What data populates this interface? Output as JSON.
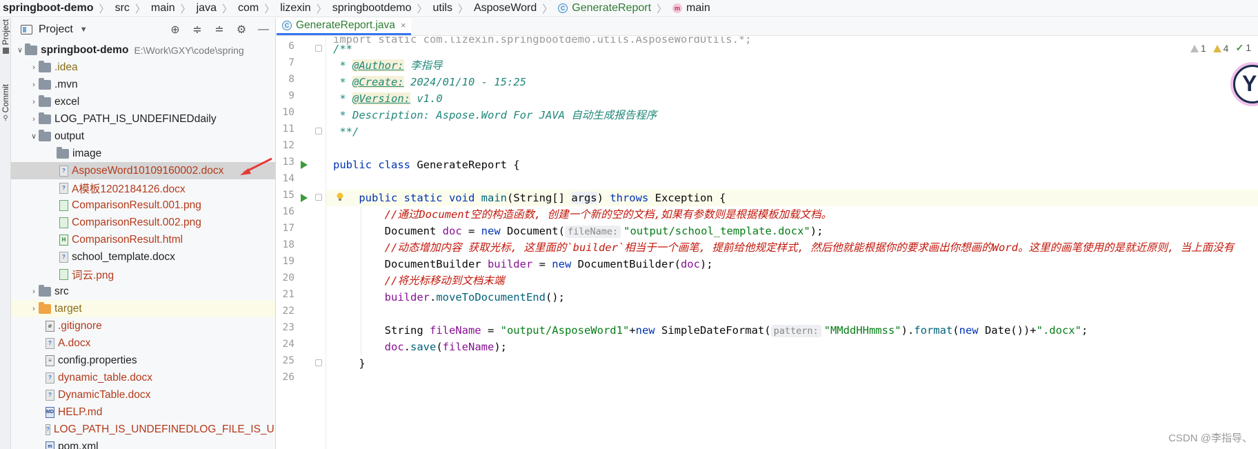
{
  "breadcrumb": {
    "items": [
      "springboot-demo",
      "src",
      "main",
      "java",
      "com",
      "lizexin",
      "springbootdemo",
      "utils",
      "AsposeWord",
      "GenerateReport",
      "main"
    ]
  },
  "sidebar_strip": {
    "project_tab": "Project",
    "commit_tab": "Commit"
  },
  "project_panel": {
    "title": "Project",
    "tree": [
      {
        "name": "springboot-demo",
        "hint": "E:\\Work\\GXY\\code\\spring"
      },
      {
        "name": ".idea"
      },
      {
        "name": ".mvn"
      },
      {
        "name": "excel"
      },
      {
        "name": "LOG_PATH_IS_UNDEFINEDdaily"
      },
      {
        "name": "output"
      },
      {
        "name": "image"
      },
      {
        "name": "AsposeWord10109160002.docx"
      },
      {
        "name": "A模板1202184126.docx"
      },
      {
        "name": "ComparisonResult.001.png"
      },
      {
        "name": "ComparisonResult.002.png"
      },
      {
        "name": "ComparisonResult.html"
      },
      {
        "name": "school_template.docx"
      },
      {
        "name": "词云.png"
      },
      {
        "name": "src"
      },
      {
        "name": "target"
      },
      {
        "name": ".gitignore"
      },
      {
        "name": "A.docx"
      },
      {
        "name": "config.properties"
      },
      {
        "name": "dynamic_table.docx"
      },
      {
        "name": "DynamicTable.docx"
      },
      {
        "name": "HELP.md"
      },
      {
        "name": "LOG_PATH_IS_UNDEFINEDLOG_FILE_IS_UN"
      },
      {
        "name": "pom.xml"
      }
    ]
  },
  "editor": {
    "tab_label": "GenerateReport.java",
    "top_partial": "import static com.lizexin.springbootdemo.utils.AsposeWordUtils.*;",
    "line_numbers": [
      "6",
      "7",
      "8",
      "9",
      "10",
      "11",
      "12",
      "13",
      "14",
      "15",
      "16",
      "17",
      "18",
      "19",
      "20",
      "21",
      "22",
      "23",
      "24",
      "25",
      "26"
    ],
    "inspections": {
      "weak": "1",
      "warn": "4",
      "ok": "1"
    },
    "code": {
      "l6": "/**",
      "l7_pre": " * ",
      "l7_tag": "@Author:",
      "l7_val": " 李指导",
      "l8_pre": " * ",
      "l8_tag": "@Create:",
      "l8_val": " 2024/01/10 - 15:25",
      "l9_pre": " * ",
      "l9_tag": "@Version:",
      "l9_val": " v1.0",
      "l10": " * Description: Aspose.Word For JAVA 自动生成报告程序",
      "l11": " **/",
      "l13_kw": "public class",
      "l13_rest": " GenerateReport {",
      "l15_kw": "public static void",
      "l15_m": "main",
      "l15_a": "(String[] ",
      "l15_var": "args",
      "l15_b": ") ",
      "l15_kw2": "throws",
      "l15_c": " Exception {",
      "l16": "//通过Document空的构造函数, 创建一个新的空的文档,如果有参数则是根据模板加载文档。",
      "l17_a": "Document ",
      "l17_var": "doc",
      "l17_b": " = ",
      "l17_kw": "new",
      "l17_c": " Document(",
      "l17_hint": "fileName:",
      "l17_str": "\"output/school_template.docx\"",
      "l17_d": ");",
      "l18": "//动态增加内容 获取光标, 这里面的`builder`相当于一个画笔, 提前给他规定样式, 然后他就能根据你的要求画出你想画的Word。这里的画笔使用的是就近原则, 当上面没有",
      "l19_a": "DocumentBuilder ",
      "l19_var": "builder",
      "l19_b": " = ",
      "l19_kw": "new",
      "l19_c": " DocumentBuilder(",
      "l19_var2": "doc",
      "l19_d": ");",
      "l20": "//将光标移动到文档末端",
      "l21_var": "builder",
      "l21_a": ".",
      "l21_m": "moveToDocumentEnd",
      "l21_b": "();",
      "l23_a": "String ",
      "l23_var": "fileName",
      "l23_b": " = ",
      "l23_str": "\"output/AsposeWord1\"",
      "l23_c": "+",
      "l23_kw": "new",
      "l23_d": " SimpleDateFormat(",
      "l23_hint": "pattern:",
      "l23_str2": "\"MMddHHmmss\"",
      "l23_e": ").",
      "l23_m": "format",
      "l23_f": "(",
      "l23_kw2": "new",
      "l23_g": " Date())+",
      "l23_str3": "\".docx\"",
      "l23_h": ";",
      "l24_var": "doc",
      "l24_a": ".",
      "l24_m": "save",
      "l24_b": "(",
      "l24_var2": "fileName",
      "l24_c": ");",
      "l25": "}"
    }
  },
  "watermark": "CSDN @李指导、",
  "colors": {
    "accent": "#3574f0",
    "comment": "#c2180c",
    "doc": "#21887a",
    "keyword": "#0033b3",
    "string": "#067d17"
  }
}
